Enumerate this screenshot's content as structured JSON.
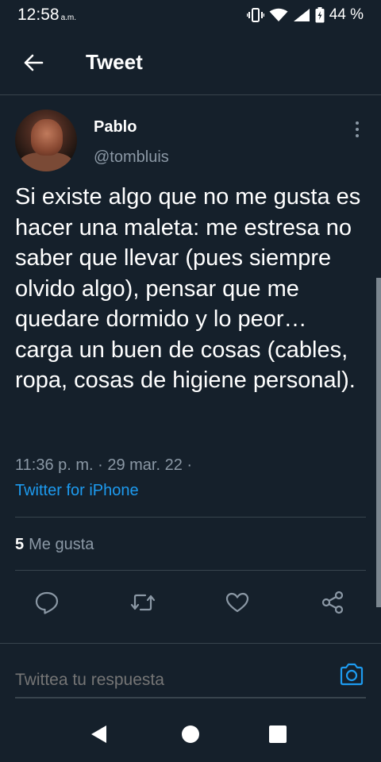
{
  "status_bar": {
    "time": "12:58",
    "ampm": "a.m.",
    "battery": "44 %",
    "icons": [
      "vibrate-icon",
      "wifi-icon",
      "signal-icon",
      "battery-icon"
    ]
  },
  "app_bar": {
    "title": "Tweet",
    "back_icon": "back-arrow-icon"
  },
  "tweet": {
    "author_name": "Pablo",
    "author_handle": "@tombluis",
    "text": "Si existe algo que no me gusta es hacer una maleta: me estresa no saber que llevar (pues siempre olvido algo), pensar que me quedare dormido y lo peor… carga un buen de cosas (cables, ropa, cosas de higiene personal).",
    "timestamp": "11:36 p. m. · 29 mar. 22 ·",
    "source": "Twitter for iPhone",
    "likes_count": "5",
    "likes_label": "Me gusta",
    "actions": [
      "reply-icon",
      "retweet-icon",
      "like-icon",
      "share-icon"
    ]
  },
  "reply": {
    "placeholder": "Twittea tu respuesta",
    "camera_icon": "camera-icon"
  },
  "nav": [
    "back-triangle-icon",
    "home-circle-icon",
    "recents-square-icon"
  ],
  "colors": {
    "background": "#15202b",
    "accent": "#1d9bf0",
    "secondary_text": "#8b98a5",
    "divider": "#38444d"
  }
}
